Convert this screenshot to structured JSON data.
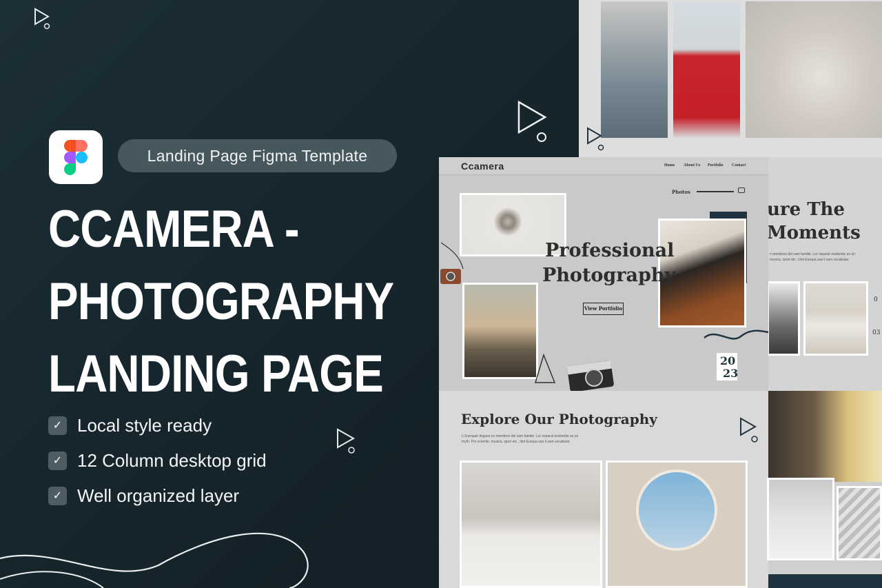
{
  "hero": {
    "badge": "Landing Page Figma Template",
    "title_lines": [
      "CCAMERA -",
      "PHOTOGRAPHY",
      "LANDING PAGE"
    ],
    "features": [
      "Local style ready",
      "12 Column desktop grid",
      "Well organized layer"
    ],
    "check_symbol": "✓"
  },
  "mockup": {
    "logo": "Ccamera",
    "nav": [
      "Home",
      "About Us",
      "Portfolio",
      "Contact"
    ],
    "photos_label": "Photos",
    "headline": [
      "Professional",
      "Photography"
    ],
    "cta": "View Portfolio",
    "year": [
      "20",
      "23"
    ],
    "side_headline": [
      "ure The",
      "Moments"
    ],
    "side_text": [
      "n membres del sam familie. Lor separat existentie es un",
      "musica, sport etc. Litot Europa usa li sam vocabular"
    ],
    "explore_title": "Explore Our Photography",
    "explore_text": [
      "Li Europan lingues es membres del sam familie. Lor separat existentie es un",
      "myth. Por scientie, musica, sport etc., litot Europa usa li sam vocabular"
    ],
    "side_digits": [
      "0",
      "03"
    ]
  },
  "colors": {
    "background": "#17282f",
    "badge": "#46575d",
    "mock_bg": "#c9c9c9",
    "accent_dark": "#1f3440"
  },
  "icons": [
    "play-outline-icon",
    "figma-logo-icon",
    "check-icon",
    "camera-icon"
  ]
}
